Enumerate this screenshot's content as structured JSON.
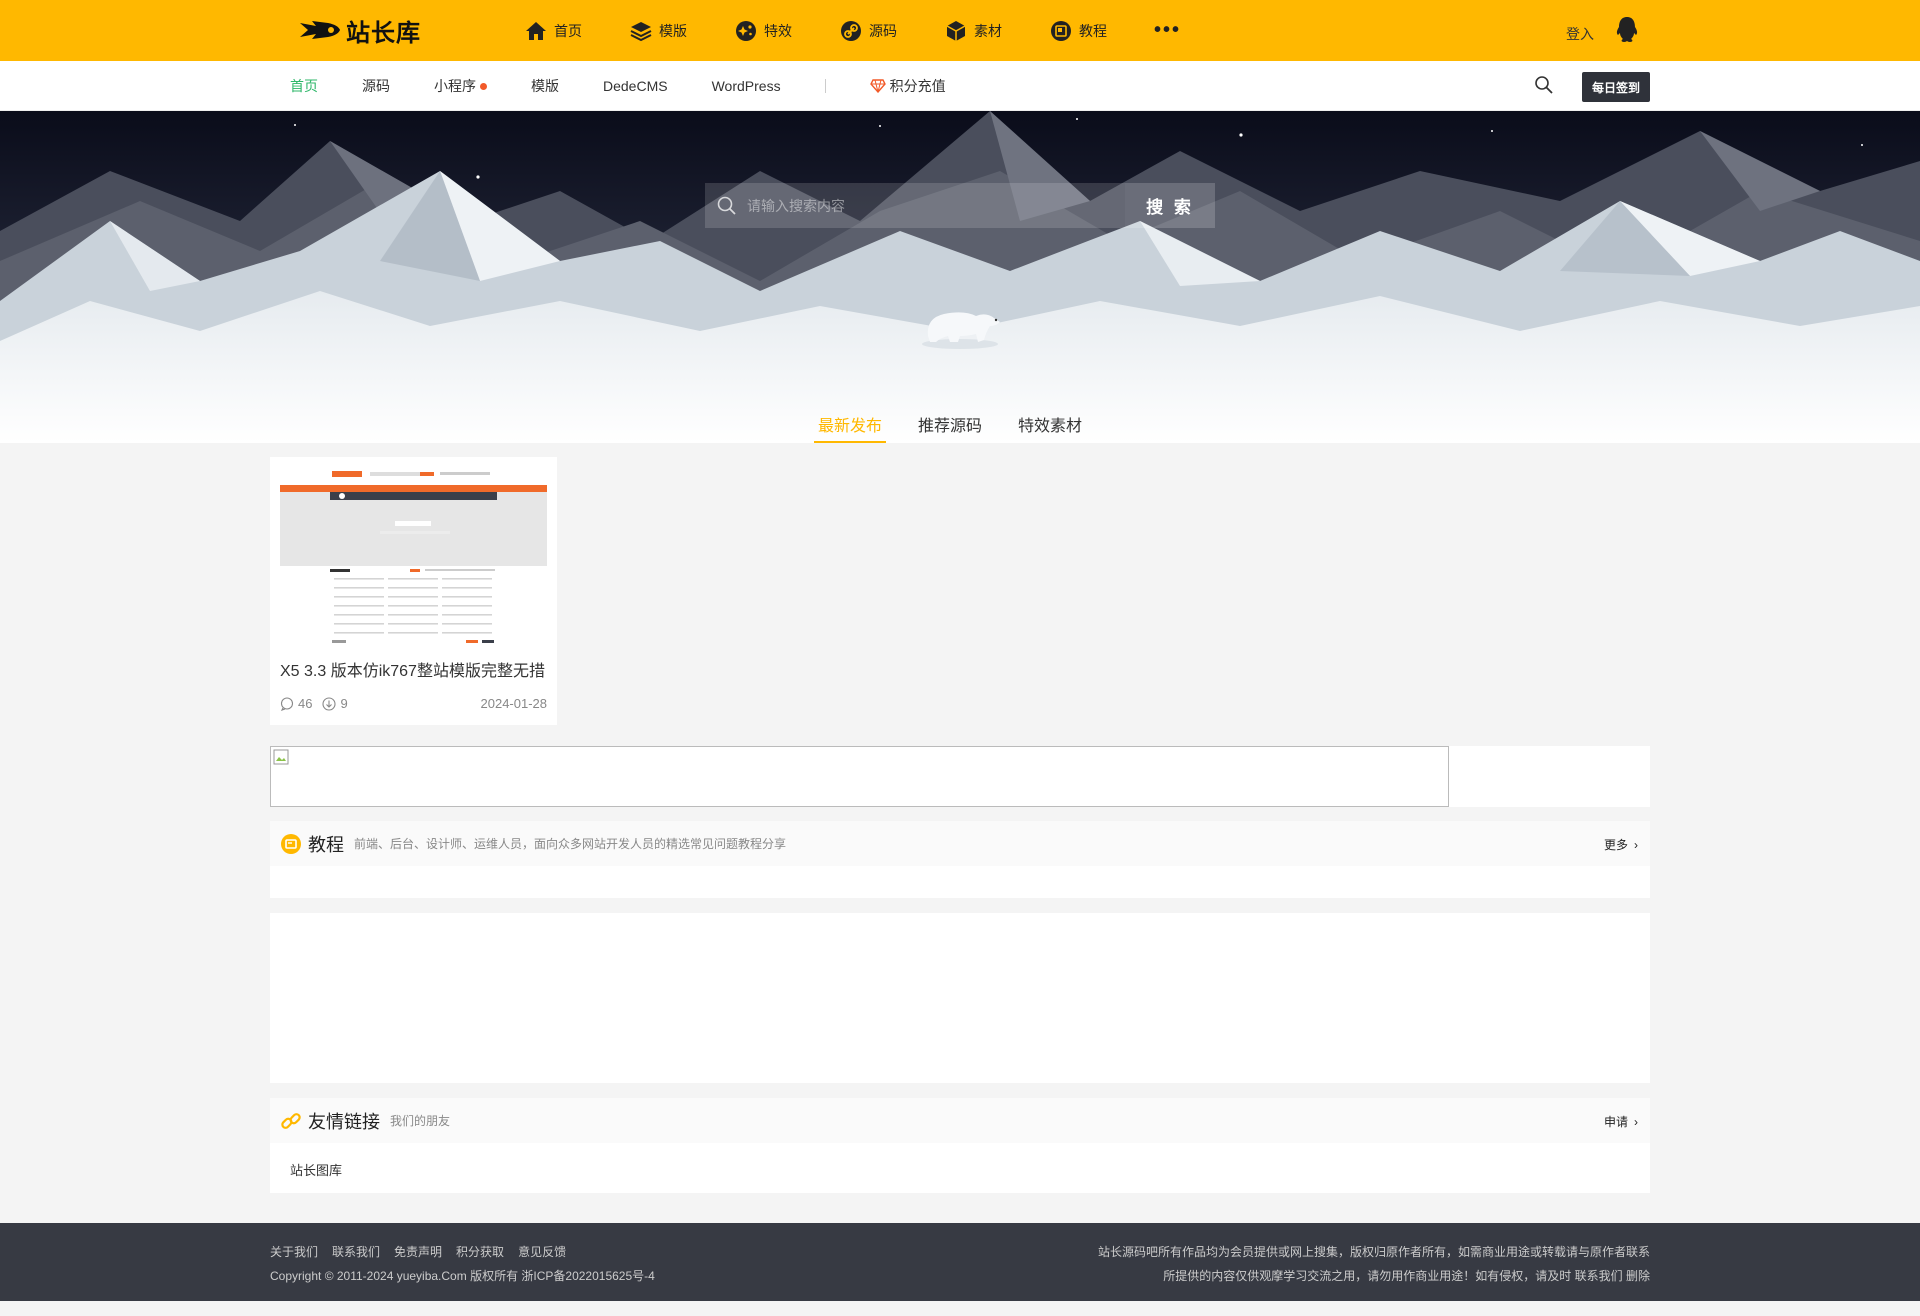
{
  "brand": {
    "logo_text": "站长库"
  },
  "mainnav": [
    {
      "label": "首页",
      "icon": "home-icon"
    },
    {
      "label": "模版",
      "icon": "layers-icon"
    },
    {
      "label": "特效",
      "icon": "sparkle-icon"
    },
    {
      "label": "源码",
      "icon": "link-icon"
    },
    {
      "label": "素材",
      "icon": "box-icon"
    },
    {
      "label": "教程",
      "icon": "book-icon"
    }
  ],
  "header": {
    "more": "•••",
    "login": "登入"
  },
  "subnav": {
    "items": [
      "首页",
      "源码",
      "小程序",
      "模版",
      "DedeCMS",
      "WordPress"
    ],
    "recharge": "积分充值",
    "signin": "每日签到"
  },
  "hero": {
    "search_placeholder": "请输入搜索内容",
    "search_button": "搜 索"
  },
  "tabs": [
    "最新发布",
    "推荐源码",
    "特效素材"
  ],
  "card": {
    "title": "X5 3.3 版本仿ik767整站模版完整无措",
    "comments": "46",
    "downloads": "9",
    "date": "2024-01-28"
  },
  "tutorial": {
    "title": "教程",
    "desc": "前端、后台、设计师、运维人员，面向众多网站开发人员的精选常见问题教程分享",
    "more": "更多"
  },
  "friends": {
    "title": "友情链接",
    "desc": "我们的朋友",
    "apply": "申请",
    "links": [
      "站长图库"
    ]
  },
  "footer": {
    "links": [
      "关于我们",
      "联系我们",
      "免责声明",
      "积分获取",
      "意见反馈"
    ],
    "copyright": "Copyright © 2011-2024 yueyiba.Com 版权所有  浙ICP备2022015625号-4",
    "notice1": "站长源码吧所有作品均为会员提供或网上搜集，版权归原作者所有，如需商业用途或转载请与原作者联系",
    "notice2": "所提供的内容仅供观摩学习交流之用，请勿用作商业用途！如有侵权，请及时",
    "contact": "联系我们",
    "delete": "删除"
  },
  "colors": {
    "accent": "#ffb800",
    "active_green": "#2fb76a",
    "footer_bg": "#373a43"
  }
}
